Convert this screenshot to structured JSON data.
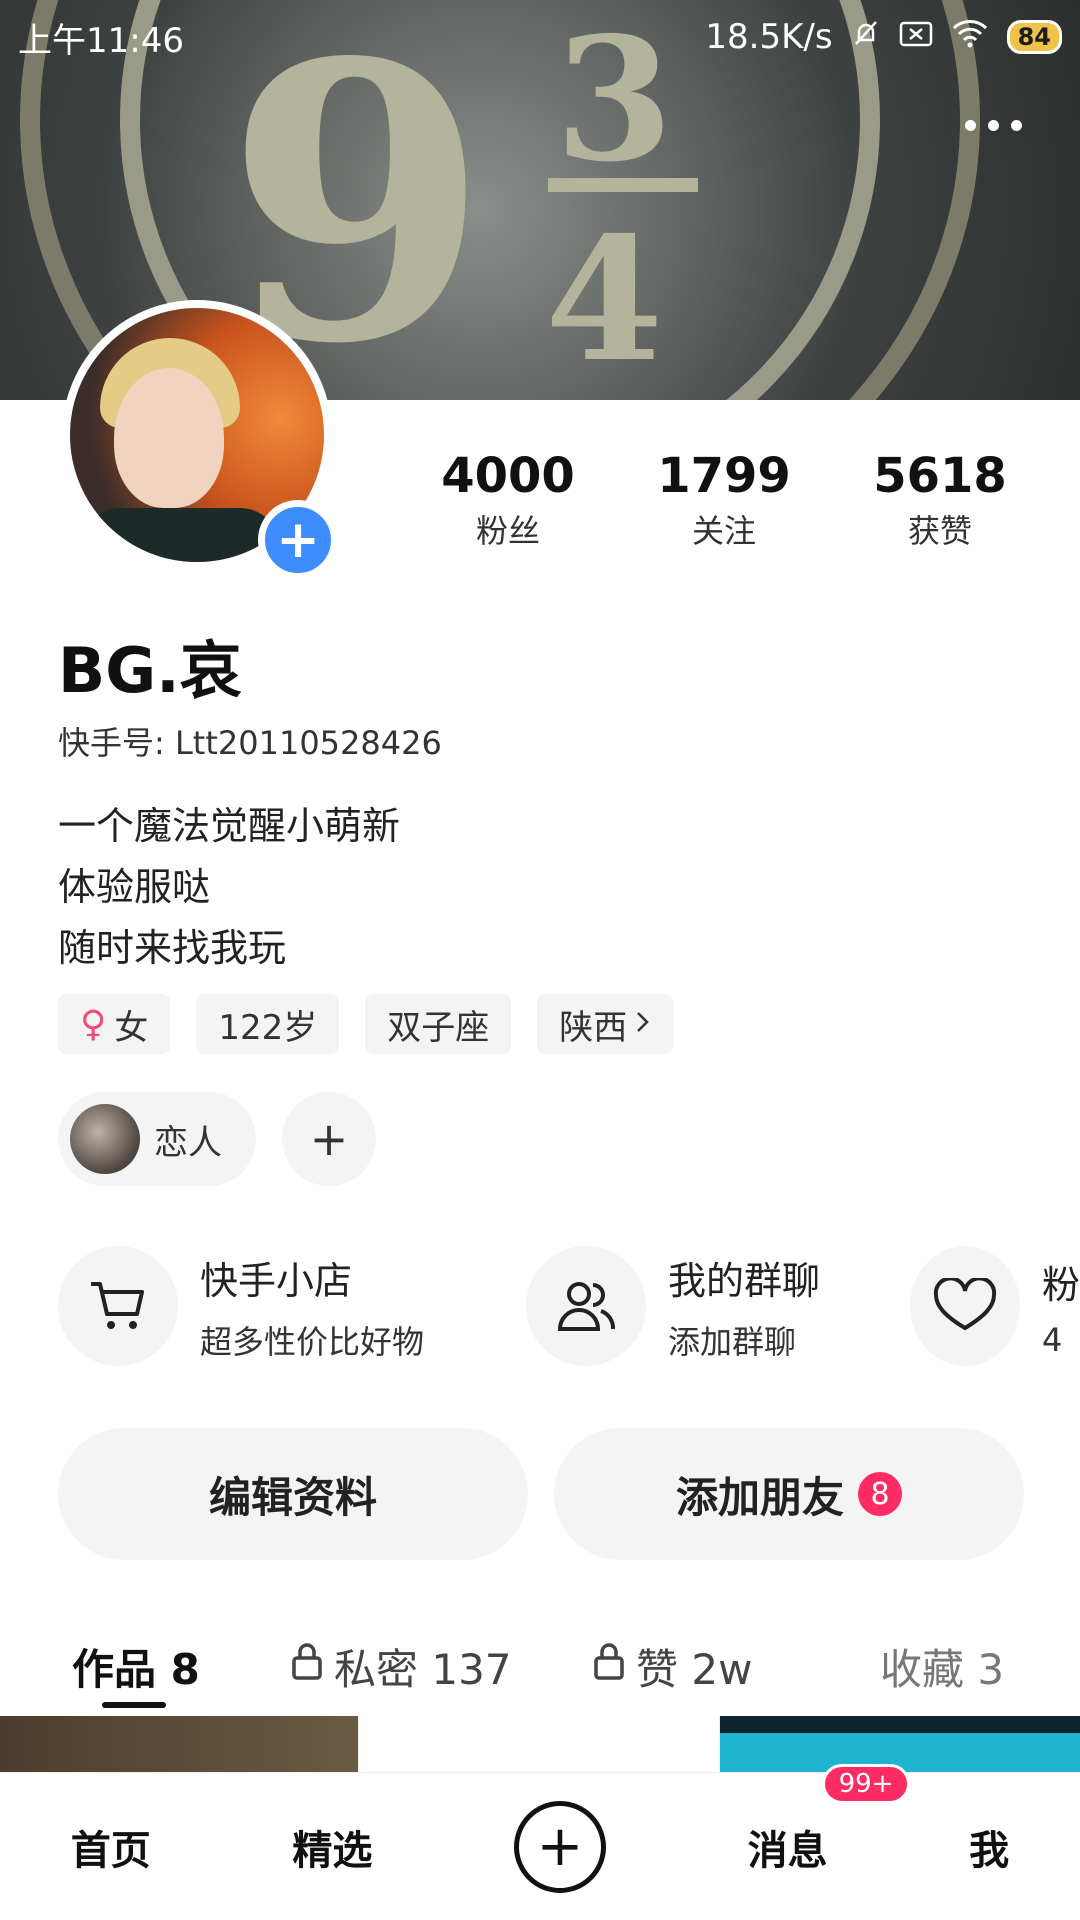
{
  "status_bar": {
    "time": "上午11:46",
    "speed": "18.5K/s",
    "battery": "84"
  },
  "cover": {
    "text_big": "9",
    "text_frac_top": "3",
    "text_frac_bottom": "4"
  },
  "profile": {
    "stats": [
      {
        "num": "4000",
        "label": "粉丝"
      },
      {
        "num": "1799",
        "label": "关注"
      },
      {
        "num": "5618",
        "label": "获赞"
      }
    ],
    "name": "BG.哀",
    "kuaishou_id": "快手号: Ltt20110528426",
    "bio": [
      "一个魔法觉醒小萌新",
      "体验服哒",
      "随时来找我玩"
    ],
    "tags": {
      "gender": "女",
      "age": "122岁",
      "zodiac": "双子座",
      "location": "陕西"
    },
    "relation": "恋人"
  },
  "features": [
    {
      "title": "快手小店",
      "sub": "超多性价比好物"
    },
    {
      "title": "我的群聊",
      "sub": "添加群聊"
    },
    {
      "title": "粉",
      "sub": "4"
    }
  ],
  "buttons": {
    "edit": "编辑资料",
    "add_friend": "添加朋友",
    "add_friend_badge": "8"
  },
  "tabs": [
    {
      "label": "作品 8"
    },
    {
      "label": "私密 137"
    },
    {
      "label": "赞 2w"
    },
    {
      "label": "收藏 3"
    }
  ],
  "bottom_nav": {
    "home": "首页",
    "featured": "精选",
    "messages": "消息",
    "messages_badge": "99+",
    "me": "我"
  }
}
